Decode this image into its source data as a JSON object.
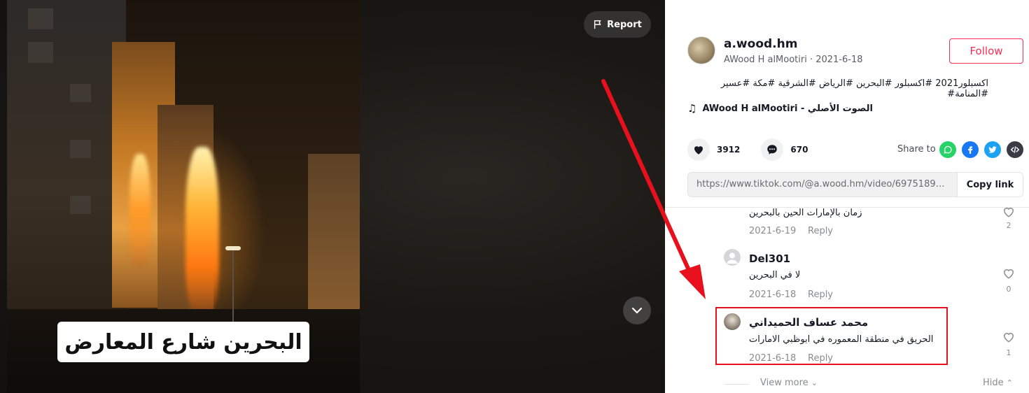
{
  "video": {
    "caption": "البحرين شارع المعارض",
    "report_label": "Report",
    "report_icon": "flag-icon",
    "next_icon": "chevron-down-icon"
  },
  "author": {
    "username": "a.wood.hm",
    "display_line": "AWood H alMootiri · 2021-6-18",
    "follow_label": "Follow"
  },
  "post": {
    "description": "اكسبلور2021 #اكسبلور #البحرين #الرياض #الشرقية #مكة #عسير #المنامة#",
    "music": "AWood H alMootiri - الصوت الأصلي"
  },
  "actions": {
    "likes": "3912",
    "comments": "670",
    "share_label": "Share to",
    "share_icons": [
      "whatsapp-icon",
      "facebook-icon",
      "twitter-icon",
      "embed-icon"
    ]
  },
  "link": {
    "url": "https://www.tiktok.com/@a.wood.hm/video/6975189649944...",
    "copy_label": "Copy link"
  },
  "comments": [
    {
      "name": "",
      "text": "زمان بالإمارات الحين بالبحرين",
      "date": "2021-6-19",
      "reply": "Reply",
      "likes": "2"
    },
    {
      "name": "Del301",
      "text": "لا في البحرين",
      "date": "2021-6-18",
      "reply": "Reply",
      "likes": "0"
    },
    {
      "name": "محمد عساف الحميداني",
      "text": "الحريق في منطقة المعموره في ابوظبي الامارات",
      "date": "2021-6-18",
      "reply": "Reply",
      "likes": "1"
    }
  ],
  "thread": {
    "view_more": "View more",
    "hide": "Hide"
  },
  "colors": {
    "accent": "#fe2c55",
    "annotation": "#e8101c"
  }
}
